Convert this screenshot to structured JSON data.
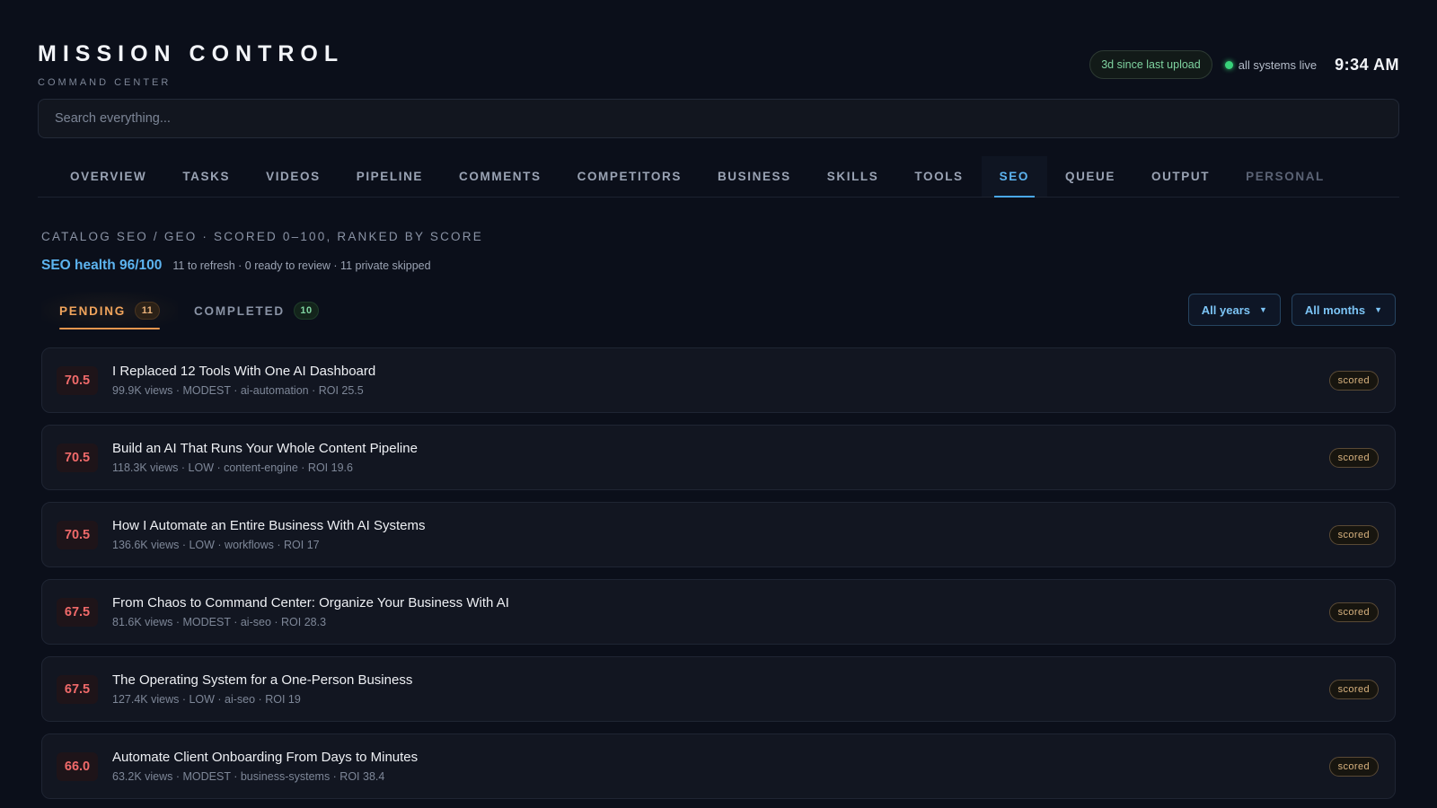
{
  "header": {
    "title": "MISSION CONTROL",
    "subtitle": "COMMAND CENTER",
    "upload_badge": "3d since last upload",
    "status_text": "all systems live",
    "time": "9:34 AM"
  },
  "search": {
    "placeholder": "Search everything..."
  },
  "tabs": [
    {
      "label": "OVERVIEW"
    },
    {
      "label": "TASKS"
    },
    {
      "label": "VIDEOS"
    },
    {
      "label": "PIPELINE"
    },
    {
      "label": "COMMENTS"
    },
    {
      "label": "COMPETITORS"
    },
    {
      "label": "BUSINESS"
    },
    {
      "label": "SKILLS"
    },
    {
      "label": "TOOLS"
    },
    {
      "label": "SEO"
    },
    {
      "label": "QUEUE"
    },
    {
      "label": "OUTPUT"
    },
    {
      "label": "PERSONAL"
    }
  ],
  "active_tab": "SEO",
  "section": {
    "label": "CATALOG SEO / GEO · SCORED 0–100, RANKED BY SCORE",
    "health_title": "SEO health 96/100",
    "health_stats": "11 to refresh · 0 ready to review · 11 private skipped"
  },
  "subtabs": {
    "pending_label": "PENDING",
    "pending_count": "11",
    "completed_label": "COMPLETED",
    "completed_count": "10"
  },
  "filters": {
    "years": "All years",
    "months": "All months"
  },
  "items": [
    {
      "score": "70.5",
      "title": "I Replaced 12 Tools With One AI Dashboard",
      "meta": "99.9K views · MODEST · ai-automation · ROI 25.5",
      "badge": "scored"
    },
    {
      "score": "70.5",
      "title": "Build an AI That Runs Your Whole Content Pipeline",
      "meta": "118.3K views · LOW · content-engine · ROI 19.6",
      "badge": "scored"
    },
    {
      "score": "70.5",
      "title": "How I Automate an Entire Business With AI Systems",
      "meta": "136.6K views · LOW · workflows · ROI 17",
      "badge": "scored"
    },
    {
      "score": "67.5",
      "title": "From Chaos to Command Center: Organize Your Business With AI",
      "meta": "81.6K views · MODEST · ai-seo · ROI 28.3",
      "badge": "scored"
    },
    {
      "score": "67.5",
      "title": "The Operating System for a One-Person Business",
      "meta": "127.4K views · LOW · ai-seo · ROI 19",
      "badge": "scored"
    },
    {
      "score": "66.0",
      "title": "Automate Client Onboarding From Days to Minutes",
      "meta": "63.2K views · MODEST · business-systems · ROI 38.4",
      "badge": "scored"
    }
  ]
}
